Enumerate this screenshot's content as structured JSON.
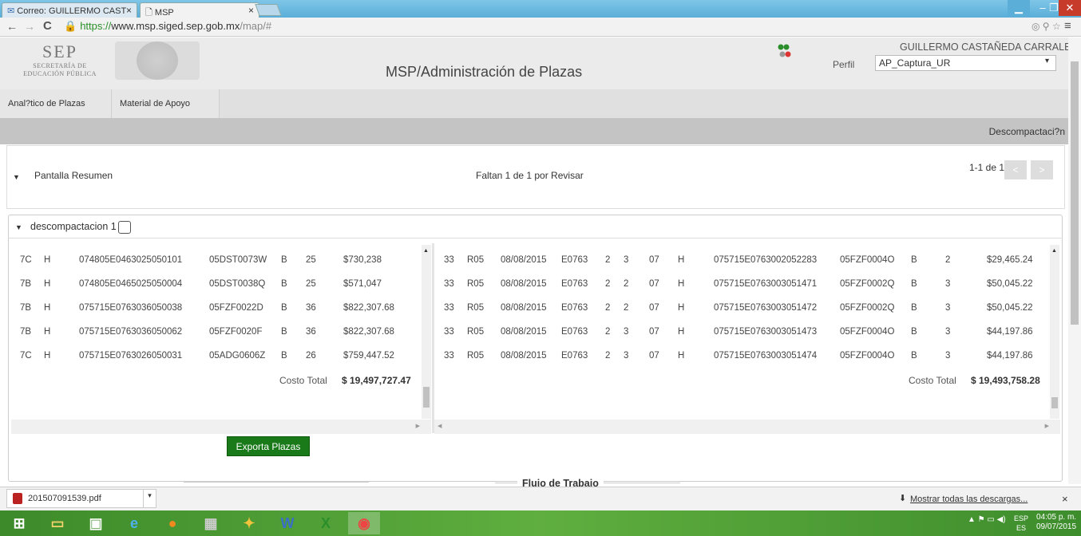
{
  "browser": {
    "tabs": [
      "Correo: GUILLERMO CAST",
      "MSP"
    ],
    "url_scheme": "https://",
    "url_host": "www.msp.siged.sep.gob.mx",
    "url_path": "/map/#"
  },
  "header": {
    "logo_text": "SEP",
    "logo_sub1": "SECRETARÍA DE",
    "logo_sub2": "EDUCACIÓN PÚBLICA",
    "title": "MSP/Administración de Plazas",
    "perfil_label": "Perfil",
    "perfil_value": "AP_Captura_UR",
    "user": "GUILLERMO CASTAÑEDA CARRALES"
  },
  "menu": [
    "Anal?tico de Plazas",
    "Material de Apoyo"
  ],
  "toolbar": {
    "descompactacion": "Descompactaci?n"
  },
  "resumen": {
    "label": "Pantalla Resumen",
    "status": "Faltan 1 de 1 por Revisar",
    "pagination": "1-1 de 1",
    "prev": "<",
    "next": ">"
  },
  "panel": {
    "title": "descompactacion 1"
  },
  "left_table": {
    "rows": [
      [
        "7C",
        "H",
        "074805E0463025050101",
        "05DST0073W",
        "B",
        "25",
        "$730,238"
      ],
      [
        "7B",
        "H",
        "074805E0465025050004",
        "05DST0038Q",
        "B",
        "25",
        "$571,047"
      ],
      [
        "7B",
        "H",
        "075715E0763036050038",
        "05FZF0022D",
        "B",
        "36",
        "$822,307.68"
      ],
      [
        "7B",
        "H",
        "075715E0763036050062",
        "05FZF0020F",
        "B",
        "36",
        "$822,307.68"
      ],
      [
        "7C",
        "H",
        "075715E0763026050031",
        "05ADG0606Z",
        "B",
        "26",
        "$759,447.52"
      ]
    ],
    "costo_label": "Costo Total",
    "costo_value": "$ 19,497,727.47"
  },
  "right_table": {
    "rows": [
      [
        "33",
        "R05",
        "08/08/2015",
        "E0763",
        "2",
        "3",
        "07",
        "H",
        "075715E0763002052283",
        "05FZF0004O",
        "B",
        "2",
        "$29,465.24"
      ],
      [
        "33",
        "R05",
        "08/08/2015",
        "E0763",
        "2",
        "2",
        "07",
        "H",
        "075715E0763003051471",
        "05FZF0002Q",
        "B",
        "3",
        "$50,045.22"
      ],
      [
        "33",
        "R05",
        "08/08/2015",
        "E0763",
        "2",
        "2",
        "07",
        "H",
        "075715E0763003051472",
        "05FZF0002Q",
        "B",
        "3",
        "$50,045.22"
      ],
      [
        "33",
        "R05",
        "08/08/2015",
        "E0763",
        "2",
        "3",
        "07",
        "H",
        "075715E0763003051473",
        "05FZF0004O",
        "B",
        "3",
        "$44,197.86"
      ],
      [
        "33",
        "R05",
        "08/08/2015",
        "E0763",
        "2",
        "3",
        "07",
        "H",
        "075715E0763003051474",
        "05FZF0004O",
        "B",
        "3",
        "$44,197.86"
      ]
    ],
    "costo_label": "Costo Total",
    "costo_value": "$ 19,493,758.28"
  },
  "export_button": "Exporta Plazas",
  "flujo_label": "Flujo de Trabajo",
  "downloads": {
    "file": "201507091539.pdf",
    "show_all": "Mostrar todas las descargas..."
  },
  "tray": {
    "lang1": "ESP",
    "lang2": "ES",
    "time": "04:05 p. m.",
    "date": "09/07/2015"
  },
  "colors": {
    "export_green": "#1a7a1a",
    "taskbar": "#4f9e35",
    "header_bg": "#ebebeb"
  }
}
